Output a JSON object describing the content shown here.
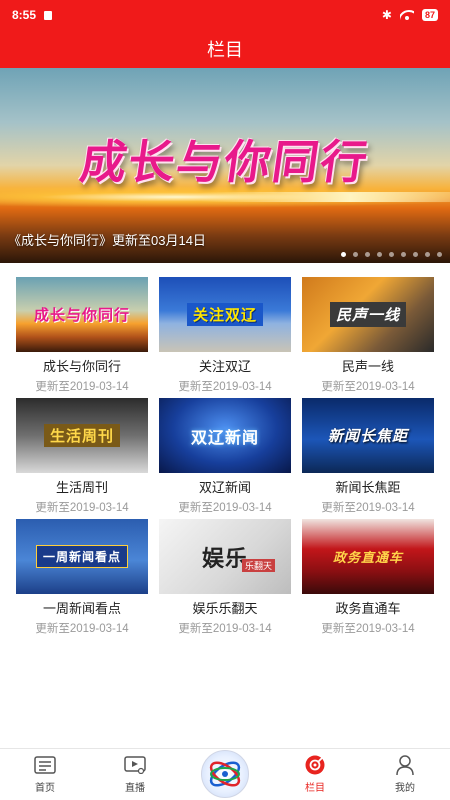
{
  "status_bar": {
    "time": "8:55",
    "bluetooth": "✱",
    "battery": "87"
  },
  "header": {
    "title": "栏目"
  },
  "banner": {
    "graphic_title": "成长与你同行",
    "caption": "《成长与你同行》更新至03月14日",
    "dot_count": 9,
    "active_dot_index": 0
  },
  "programs": [
    {
      "name": "成长与你同行",
      "date": "更新至2019-03-14",
      "thumb_text": "成长与你同行"
    },
    {
      "name": "关注双辽",
      "date": "更新至2019-03-14",
      "thumb_text": "关注双辽"
    },
    {
      "name": "民声一线",
      "date": "更新至2019-03-14",
      "thumb_text": "民声一线"
    },
    {
      "name": "生活周刊",
      "date": "更新至2019-03-14",
      "thumb_text": "生活周刊"
    },
    {
      "name": "双辽新闻",
      "date": "更新至2019-03-14",
      "thumb_text": "双辽新闻"
    },
    {
      "name": "新闻长焦距",
      "date": "更新至2019-03-14",
      "thumb_text": "新闻长焦距"
    },
    {
      "name": "一周新闻看点",
      "date": "更新至2019-03-14",
      "thumb_text": "一周新闻看点"
    },
    {
      "name": "娱乐乐翻天",
      "date": "更新至2019-03-14",
      "thumb_text": "娱乐",
      "thumb_sub": "乐翻天"
    },
    {
      "name": "政务直通车",
      "date": "更新至2019-03-14",
      "thumb_text": "政务直通车"
    }
  ],
  "tabbar": {
    "items": [
      {
        "label": "首页",
        "icon": "news-icon"
      },
      {
        "label": "直播",
        "icon": "live-video-icon"
      },
      {
        "label": "",
        "icon": "station-logo-icon"
      },
      {
        "label": "栏目",
        "icon": "columns-icon",
        "active": true
      },
      {
        "label": "我的",
        "icon": "user-icon"
      }
    ],
    "active_color": "#e8241f"
  },
  "colors": {
    "header_bg": "#f01a1a",
    "accent": "#e8241f"
  }
}
